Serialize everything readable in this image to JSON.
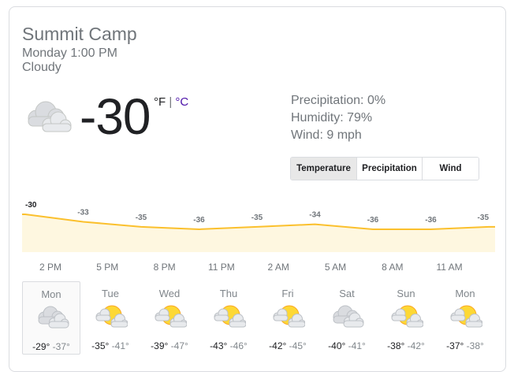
{
  "location": "Summit Camp",
  "datetime": "Monday 1:00 PM",
  "condition": "Cloudy",
  "current": {
    "icon": "cloud-icon",
    "temp": "-30",
    "unit_f": "°F",
    "separator": "|",
    "unit_c": "°C"
  },
  "details": {
    "precipitation": "Precipitation: 0%",
    "humidity": "Humidity: 79%",
    "wind": "Wind: 9 mph"
  },
  "tabs": [
    "Temperature",
    "Precipitation",
    "Wind"
  ],
  "chart_data": {
    "type": "area",
    "values": [
      -30,
      -33,
      -35,
      -36,
      -35,
      -34,
      -36,
      -36,
      -35
    ],
    "labels": [
      "-30",
      "-33",
      "-35",
      "-36",
      "-35",
      "-34",
      "-36",
      "-36",
      "-35"
    ],
    "x_labels": [
      "2 PM",
      "5 PM",
      "8 PM",
      "11 PM",
      "2 AM",
      "5 AM",
      "8 AM",
      "11 AM"
    ],
    "color": "#fbc02d",
    "fill": "#fef7e0"
  },
  "days": [
    {
      "name": "Mon",
      "icon": "cloud-icon",
      "hi": "-29°",
      "lo": "-37°",
      "selected": true
    },
    {
      "name": "Tue",
      "icon": "partly-cloudy-night-icon",
      "hi": "-35°",
      "lo": "-41°"
    },
    {
      "name": "Wed",
      "icon": "partly-cloudy-night-icon",
      "hi": "-39°",
      "lo": "-47°"
    },
    {
      "name": "Thu",
      "icon": "partly-cloudy-night-icon",
      "hi": "-43°",
      "lo": "-46°"
    },
    {
      "name": "Fri",
      "icon": "partly-cloudy-night-icon",
      "hi": "-42°",
      "lo": "-45°"
    },
    {
      "name": "Sat",
      "icon": "cloud-icon",
      "hi": "-40°",
      "lo": "-41°"
    },
    {
      "name": "Sun",
      "icon": "partly-cloudy-night-icon",
      "hi": "-38°",
      "lo": "-42°"
    },
    {
      "name": "Mon",
      "icon": "partly-cloudy-night-icon",
      "hi": "-37°",
      "lo": "-38°"
    }
  ]
}
